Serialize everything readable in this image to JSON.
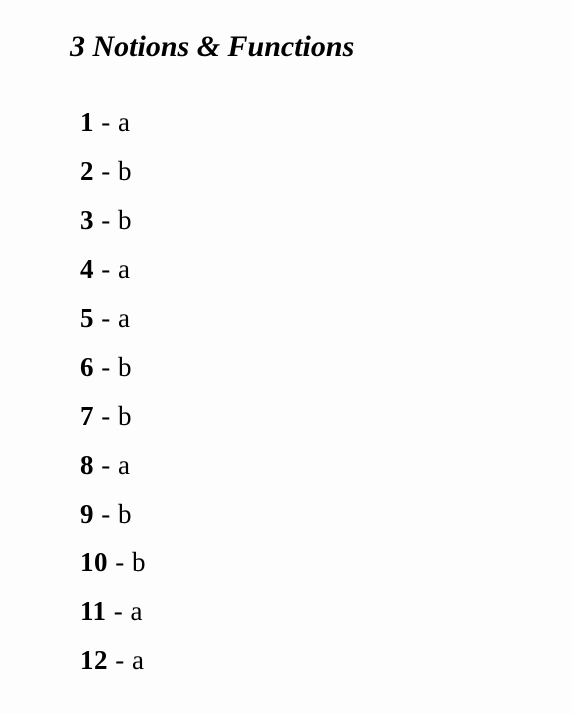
{
  "heading": "3 Notions & Functions",
  "items": [
    {
      "num": "1",
      "sep": " - ",
      "val": "a"
    },
    {
      "num": "2",
      "sep": " - ",
      "val": "b"
    },
    {
      "num": "3",
      "sep": " - ",
      "val": "b"
    },
    {
      "num": "4",
      "sep": " - ",
      "val": "a"
    },
    {
      "num": "5",
      "sep": " - ",
      "val": "a"
    },
    {
      "num": "6",
      "sep": " - ",
      "val": "b"
    },
    {
      "num": "7",
      "sep": " - ",
      "val": "b"
    },
    {
      "num": "8",
      "sep": " - ",
      "val": "a"
    },
    {
      "num": "9",
      "sep": " - ",
      "val": "b"
    },
    {
      "num": "10",
      "sep": " - ",
      "val": "b"
    },
    {
      "num": "11",
      "sep": " - ",
      "val": "a"
    },
    {
      "num": "12",
      "sep": " - ",
      "val": "a"
    }
  ]
}
